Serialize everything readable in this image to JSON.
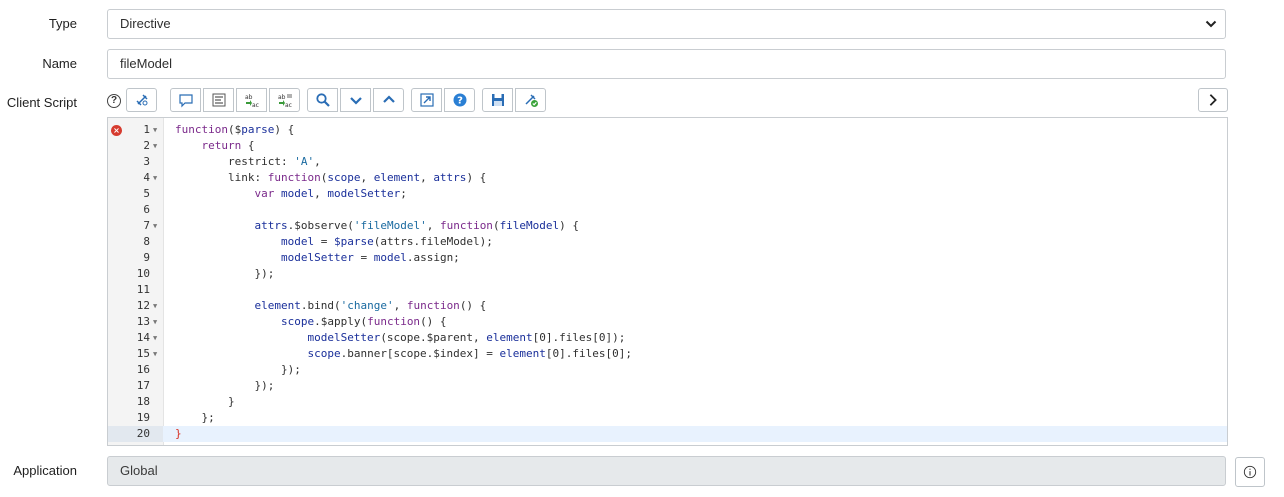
{
  "form": {
    "type_label": "Type",
    "type_value": "Directive",
    "name_label": "Name",
    "name_value": "fileModel",
    "client_script_label": "Client Script",
    "application_label": "Application",
    "application_value": "Global"
  },
  "toolbar": {
    "help_text": "?",
    "buttons": [
      "script-include-icon",
      "comment-icon",
      "format-code-icon",
      "replace-icon",
      "replace-all-icon",
      "search-icon",
      "find-next-icon",
      "find-previous-icon",
      "fullscreen-icon",
      "help-icon",
      "save-icon",
      "script-debug-icon"
    ]
  },
  "editor": {
    "error_line": 1,
    "active_line": 20,
    "lines": [
      {
        "n": "1",
        "fold": true
      },
      {
        "n": "2",
        "fold": true
      },
      {
        "n": "3",
        "fold": false
      },
      {
        "n": "4",
        "fold": true
      },
      {
        "n": "5",
        "fold": false
      },
      {
        "n": "6",
        "fold": false
      },
      {
        "n": "7",
        "fold": true
      },
      {
        "n": "8",
        "fold": false
      },
      {
        "n": "9",
        "fold": false
      },
      {
        "n": "10",
        "fold": false
      },
      {
        "n": "11",
        "fold": false
      },
      {
        "n": "12",
        "fold": true
      },
      {
        "n": "13",
        "fold": true
      },
      {
        "n": "14",
        "fold": true
      },
      {
        "n": "15",
        "fold": true
      },
      {
        "n": "16",
        "fold": false
      },
      {
        "n": "17",
        "fold": false
      },
      {
        "n": "18",
        "fold": false
      },
      {
        "n": "19",
        "fold": false
      },
      {
        "n": "20",
        "fold": false
      }
    ],
    "code": [
      [
        [
          "kw",
          "function"
        ],
        [
          "",
          "($"
        ],
        [
          "var",
          "parse"
        ],
        [
          "",
          ") {"
        ]
      ],
      [
        [
          "",
          "    "
        ],
        [
          "kw",
          "return"
        ],
        [
          "",
          " {"
        ]
      ],
      [
        [
          "",
          "        restrict: "
        ],
        [
          "str",
          "'A'"
        ],
        [
          "",
          ","
        ]
      ],
      [
        [
          "",
          "        link: "
        ],
        [
          "kw",
          "function"
        ],
        [
          "",
          "("
        ],
        [
          "var",
          "scope"
        ],
        [
          "",
          ", "
        ],
        [
          "var",
          "element"
        ],
        [
          "",
          ", "
        ],
        [
          "var",
          "attrs"
        ],
        [
          "",
          ") {"
        ]
      ],
      [
        [
          "",
          "            "
        ],
        [
          "kw",
          "var"
        ],
        [
          "",
          " "
        ],
        [
          "var",
          "model"
        ],
        [
          "",
          ", "
        ],
        [
          "var",
          "modelSetter"
        ],
        [
          "",
          ";"
        ]
      ],
      [
        [
          "",
          ""
        ]
      ],
      [
        [
          "",
          "            "
        ],
        [
          "var",
          "attrs"
        ],
        [
          "",
          ".$observe("
        ],
        [
          "str",
          "'fileModel'"
        ],
        [
          "",
          ", "
        ],
        [
          "kw",
          "function"
        ],
        [
          "",
          "("
        ],
        [
          "var",
          "fileModel"
        ],
        [
          "",
          ") {"
        ]
      ],
      [
        [
          "",
          "                "
        ],
        [
          "var",
          "model"
        ],
        [
          "",
          " = "
        ],
        [
          "var",
          "$parse"
        ],
        [
          "",
          "(attrs.fileModel);"
        ]
      ],
      [
        [
          "",
          "                "
        ],
        [
          "var",
          "modelSetter"
        ],
        [
          "",
          " = "
        ],
        [
          "var",
          "model"
        ],
        [
          "",
          ".assign;"
        ]
      ],
      [
        [
          "",
          "            });"
        ]
      ],
      [
        [
          "",
          ""
        ]
      ],
      [
        [
          "",
          "            "
        ],
        [
          "var",
          "element"
        ],
        [
          "",
          ".bind("
        ],
        [
          "str",
          "'change'"
        ],
        [
          "",
          ", "
        ],
        [
          "kw",
          "function"
        ],
        [
          "",
          "() {"
        ]
      ],
      [
        [
          "",
          "                "
        ],
        [
          "var",
          "scope"
        ],
        [
          "",
          ".$apply("
        ],
        [
          "kw",
          "function"
        ],
        [
          "",
          "() {"
        ]
      ],
      [
        [
          "",
          "                    "
        ],
        [
          "var",
          "modelSetter"
        ],
        [
          "",
          "(scope.$parent, "
        ],
        [
          "var",
          "element"
        ],
        [
          "",
          "[0].files[0]);"
        ]
      ],
      [
        [
          "",
          "                    "
        ],
        [
          "var",
          "scope"
        ],
        [
          "",
          ".banner[scope.$index] = "
        ],
        [
          "var",
          "element"
        ],
        [
          "",
          "[0].files[0];"
        ]
      ],
      [
        [
          "",
          "                });"
        ]
      ],
      [
        [
          "",
          "            });"
        ]
      ],
      [
        [
          "",
          "        }"
        ]
      ],
      [
        [
          "",
          "    };"
        ]
      ],
      [
        [
          "red",
          "}"
        ]
      ]
    ]
  }
}
